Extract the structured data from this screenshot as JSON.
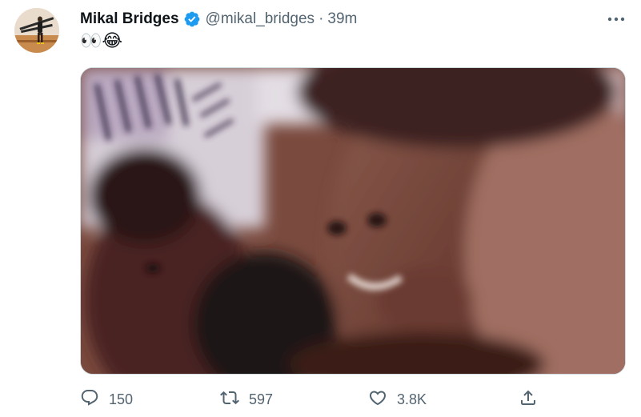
{
  "author": {
    "display_name": "Mikal Bridges",
    "handle": "@mikal_bridges",
    "separator": "·",
    "time": "39m",
    "verified": true
  },
  "tweet": {
    "text": "👀😂",
    "media_alt": "Blurry photo of smiling basketball players"
  },
  "actions": {
    "reply_count": "150",
    "retweet_count": "597",
    "like_count": "3.8K"
  },
  "icons": {
    "verified": "verified-badge-icon",
    "more": "more-options-icon",
    "reply": "reply-icon",
    "retweet": "retweet-icon",
    "like": "like-icon",
    "share": "share-icon"
  },
  "colors": {
    "primary_text": "#0f1419",
    "secondary_text": "#536471",
    "verified_blue": "#1d9bf0",
    "border": "#cfd9de"
  }
}
